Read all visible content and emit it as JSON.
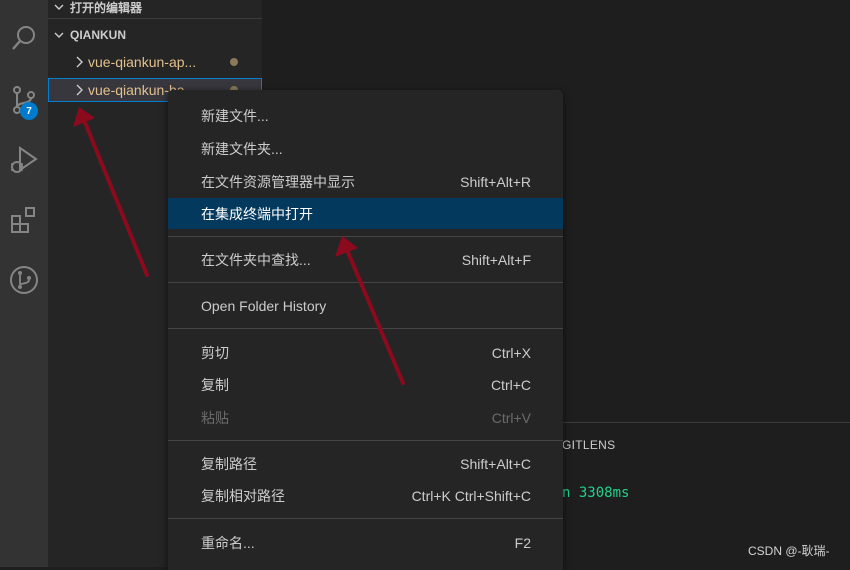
{
  "activity_bar": {
    "icons": [
      "search-icon",
      "source-control-icon",
      "run-debug-icon",
      "extensions-icon",
      "gitlens-icon"
    ],
    "badge": "7",
    "accent": "#007acc"
  },
  "sidebar": {
    "open_editors": "打开的编辑器",
    "project": "QIANKUN",
    "items": [
      {
        "label": "vue-qiankun-ap..."
      },
      {
        "label": "vue-qiankun-ba..."
      }
    ]
  },
  "panel": {
    "tab": "GITLENS",
    "output": "n 3308ms"
  },
  "context_menu": {
    "items": [
      {
        "label": "新建文件...",
        "shortcut": ""
      },
      {
        "label": "新建文件夹...",
        "shortcut": ""
      },
      {
        "label": "在文件资源管理器中显示",
        "shortcut": "Shift+Alt+R"
      },
      {
        "label": "在集成终端中打开",
        "shortcut": ""
      },
      {
        "label": "在文件夹中查找...",
        "shortcut": "Shift+Alt+F"
      },
      {
        "label": "Open Folder History",
        "shortcut": ""
      },
      {
        "label": "剪切",
        "shortcut": "Ctrl+X"
      },
      {
        "label": "复制",
        "shortcut": "Ctrl+C"
      },
      {
        "label": "粘贴",
        "shortcut": "Ctrl+V"
      },
      {
        "label": "复制路径",
        "shortcut": "Shift+Alt+C"
      },
      {
        "label": "复制相对路径",
        "shortcut": "Ctrl+K Ctrl+Shift+C"
      },
      {
        "label": "重命名...",
        "shortcut": "F2"
      }
    ]
  },
  "watermark": "CSDN @-耿瑞-",
  "annotation_color": "#8b0a1e"
}
